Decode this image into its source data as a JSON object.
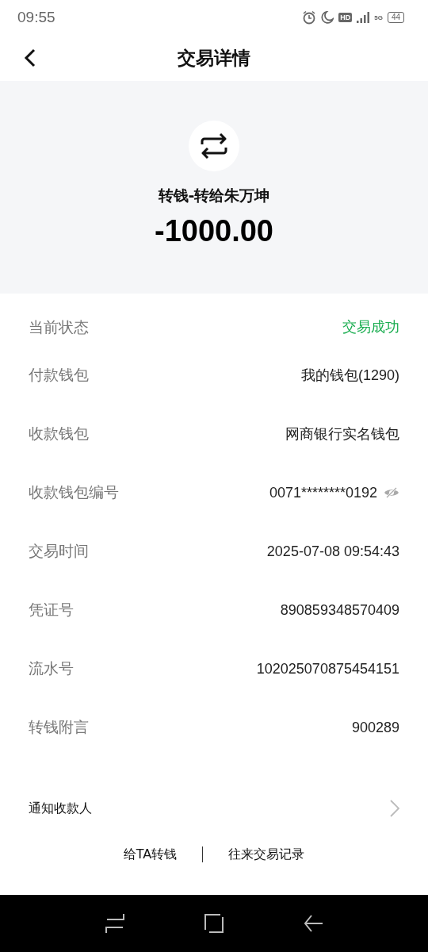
{
  "status_bar": {
    "time": "09:55",
    "hd": "HD",
    "network": "5G",
    "battery": "44"
  },
  "header": {
    "title": "交易详情"
  },
  "summary": {
    "title": "转钱-转给朱万坤",
    "amount": "-1000.00"
  },
  "details": [
    {
      "kind": "status",
      "label": "当前状态",
      "value": "交易成功",
      "color": "#1aad50"
    },
    {
      "kind": "text",
      "label": "付款钱包",
      "value": "我的钱包(1290)"
    },
    {
      "kind": "text",
      "label": "收款钱包",
      "value": "网商银行实名钱包"
    },
    {
      "kind": "masked",
      "label": "收款钱包编号",
      "value": "0071********0192"
    },
    {
      "kind": "text",
      "label": "交易时间",
      "value": "2025-07-08 09:54:43"
    },
    {
      "kind": "text",
      "label": "凭证号",
      "value": "890859348570409"
    },
    {
      "kind": "text",
      "label": "流水号",
      "value": "102025070875454151"
    },
    {
      "kind": "text",
      "label": "转钱附言",
      "value": "900289"
    }
  ],
  "notify": {
    "label": "通知收款人"
  },
  "links": [
    "给TA转钱",
    "往来交易记录"
  ]
}
